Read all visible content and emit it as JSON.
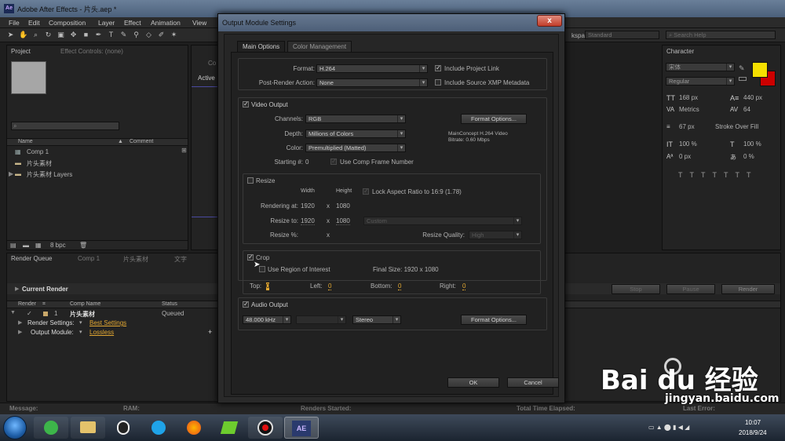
{
  "app": {
    "title": "Adobe After Effects - 片头.aep *",
    "logo": "Ae"
  },
  "menu": [
    "File",
    "Edit",
    "Composition",
    "Layer",
    "Effect",
    "Animation",
    "View"
  ],
  "workspace": {
    "label": "kspace:",
    "value": "Standard",
    "search_placeholder": "Search Help"
  },
  "project_panel": {
    "tab": "Project",
    "tab2": "Effect Controls: (none)",
    "col_name": "Name",
    "col_comment": "Comment",
    "items": [
      {
        "name": "Comp 1",
        "icon": "comp-icon"
      },
      {
        "name": "片头素材",
        "icon": "folder-icon"
      },
      {
        "name": "片头素材 Layers",
        "icon": "folder-icon"
      }
    ],
    "bpc": "8 bpc"
  },
  "viewer": {
    "active_label": "Active",
    "tab_co": "Co"
  },
  "character_panel": {
    "tab": "Character",
    "font": "宋体",
    "style": "Regular",
    "size": "168 px",
    "leading": "440 px",
    "kerning": "Metrics",
    "tracking": "64",
    "stroke_width": "67 px",
    "stroke_type": "Stroke Over Fill",
    "vscale": "100 %",
    "hscale": "100 %",
    "baseline": "0 px",
    "tsume": "0 %",
    "fill_color": "#f5e000",
    "stroke_color": "#cc0000"
  },
  "render_queue": {
    "tabs": [
      "Render Queue",
      "Comp 1",
      "片头素材",
      "文字"
    ],
    "current_render": "Current Render",
    "buttons": {
      "stop": "Stop",
      "pause": "Pause",
      "render": "Render"
    },
    "cols": {
      "render": "Render",
      "comp": "Comp Name",
      "status": "Status"
    },
    "row": {
      "num": "1",
      "comp": "片头素材",
      "status": "Queued"
    },
    "render_settings_label": "Render Settings:",
    "render_settings_value": "Best Settings",
    "output_module_label": "Output Module:",
    "output_module_value": "Lossless"
  },
  "statusbar": {
    "message": "Message:",
    "ram": "RAM:",
    "renders_started": "Renders Started:",
    "total_time": "Total Time Elapsed:",
    "last_error": "Last Error:"
  },
  "dialog": {
    "title": "Output Module Settings",
    "close": "x",
    "tabs": {
      "main": "Main Options",
      "color": "Color Management"
    },
    "format_label": "Format:",
    "format_value": "H.264",
    "post_render_label": "Post-Render Action:",
    "post_render_value": "None",
    "include_project_link": "Include Project Link",
    "include_xmp": "Include Source XMP Metadata",
    "video_output": "Video Output",
    "channels_label": "Channels:",
    "channels_value": "RGB",
    "depth_label": "Depth:",
    "depth_value": "Millions of Colors",
    "color_label": "Color:",
    "color_value": "Premultiplied (Matted)",
    "starting_label": "Starting #:",
    "starting_value": "0",
    "use_comp_frame": "Use Comp Frame Number",
    "format_options": "Format Options...",
    "codec_info": "MainConcept H.264 Video",
    "bitrate_info": "Bitrate: 0.60 Mbps",
    "resize": "Resize",
    "width_hdr": "Width",
    "height_hdr": "Height",
    "lock_aspect": "Lock Aspect Ratio to 16:9 (1.78)",
    "rendering_at_label": "Rendering at:",
    "rendering_w": "1920",
    "rendering_h": "1080",
    "x": "x",
    "resize_to_label": "Resize to:",
    "resize_to_w": "1920",
    "resize_to_h": "1080",
    "resize_preset": "Custom",
    "resize_pct_label": "Resize %:",
    "resize_quality_label": "Resize Quality:",
    "resize_quality_value": "High",
    "crop": "Crop",
    "use_roi": "Use Region of Interest",
    "final_size": "Final Size: 1920 x 1080",
    "top_label": "Top:",
    "top_value": "0",
    "left_label": "Left:",
    "left_value": "0",
    "bottom_label": "Bottom:",
    "bottom_value": "0",
    "right_label": "Right:",
    "right_value": "0",
    "audio_output": "Audio Output",
    "audio_rate": "48.000 kHz",
    "audio_channels": "Stereo",
    "ok": "OK",
    "cancel": "Cancel"
  },
  "taskbar": {
    "time": "10:07",
    "date": "2018/9/24",
    "ae_label": "AE"
  },
  "watermark": {
    "brand": "Bai du 经验",
    "url": "jingyan.baidu.com"
  }
}
